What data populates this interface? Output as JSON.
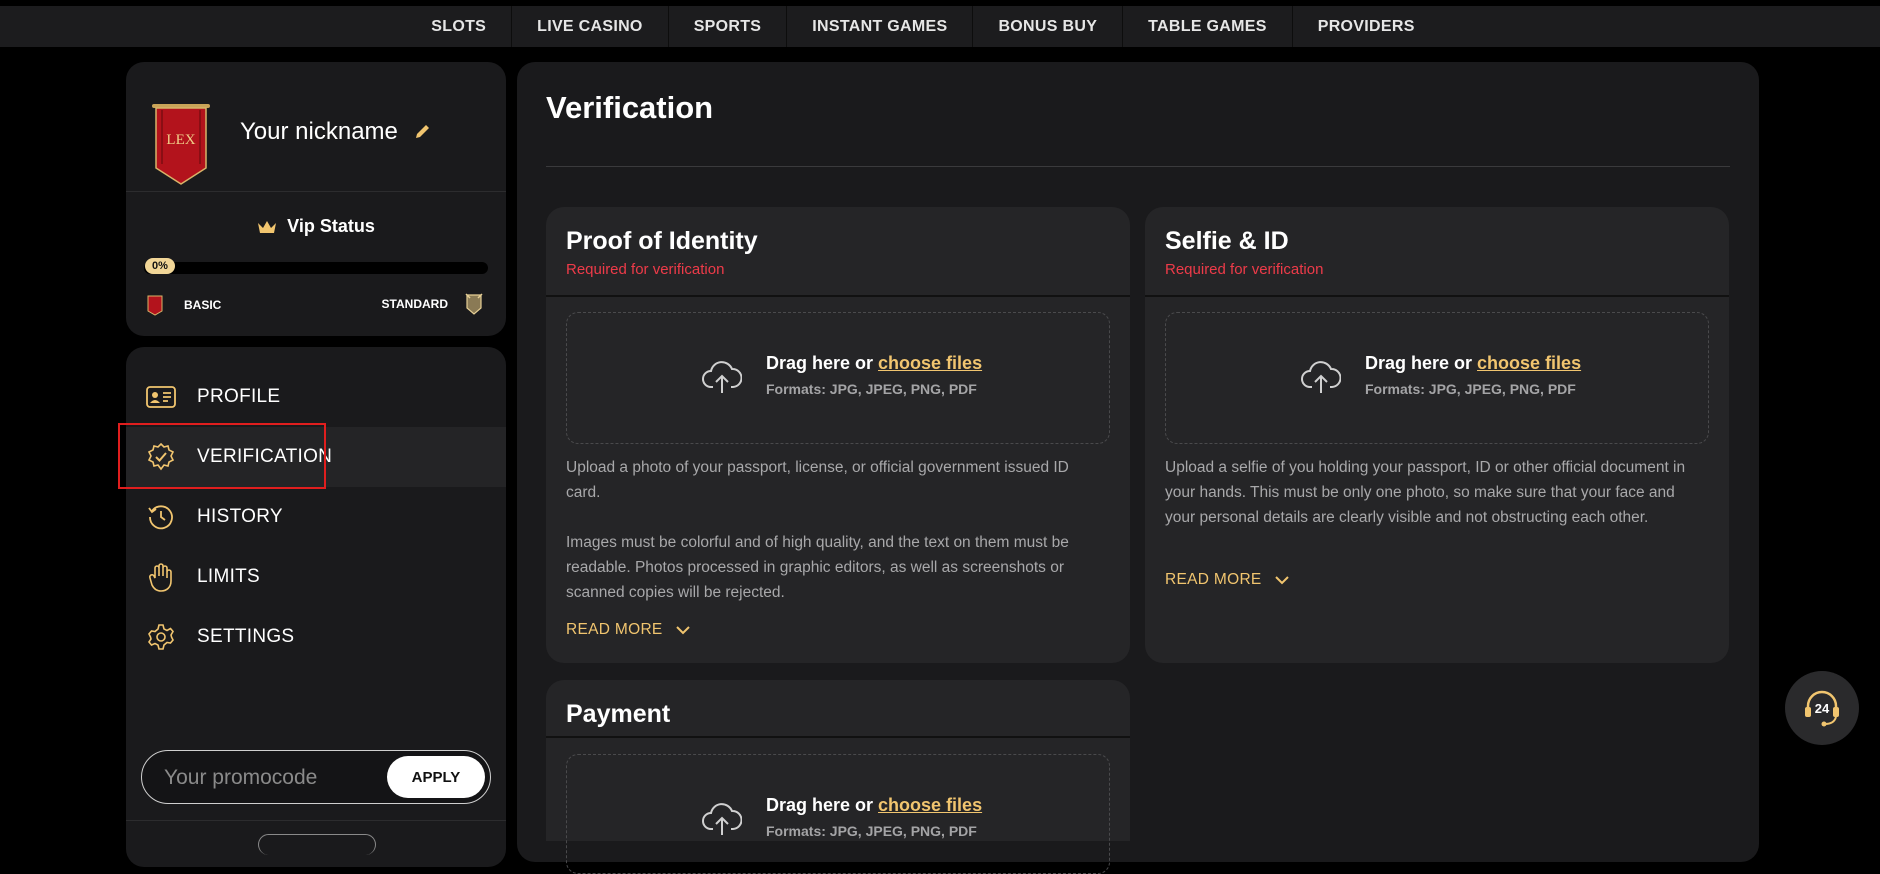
{
  "topnav": {
    "tabs": [
      "SLOTS",
      "LIVE CASINO",
      "SPORTS",
      "INSTANT GAMES",
      "BONUS BUY",
      "TABLE GAMES",
      "PROVIDERS"
    ]
  },
  "profile": {
    "logo_text": "LEX",
    "nickname": "Your nickname",
    "vip_label": "Vip Status",
    "progress_text": "0%",
    "progress_value": 0,
    "level_current": "BASIC",
    "level_next": "STANDARD"
  },
  "menu": {
    "items": [
      {
        "label": "PROFILE",
        "icon": "id-card-icon"
      },
      {
        "label": "VERIFICATION",
        "icon": "verified-badge-icon"
      },
      {
        "label": "HISTORY",
        "icon": "history-icon"
      },
      {
        "label": "LIMITS",
        "icon": "hand-icon"
      },
      {
        "label": "SETTINGS",
        "icon": "gear-icon"
      }
    ],
    "active_index": 1
  },
  "promo": {
    "placeholder": "Your promocode",
    "apply_label": "APPLY"
  },
  "main": {
    "title": "Verification",
    "cards": [
      {
        "title": "Proof of Identity",
        "required": "Required for verification",
        "drag_text": "Drag here or ",
        "choose_files": "choose files",
        "formats": "Formats: JPG, JPEG, PNG, PDF",
        "desc1": "Upload a photo of your passport, license, or official government issued ID card.",
        "desc2": "Images must be colorful and of high quality, and the text on them must be readable. Photos processed in graphic editors, as well as screenshots or scanned copies will be rejected.",
        "read_more": "READ MORE"
      },
      {
        "title": "Selfie & ID",
        "required": "Required for verification",
        "drag_text": "Drag here or ",
        "choose_files": "choose files",
        "formats": "Formats: JPG, JPEG, PNG, PDF",
        "desc1": "Upload a selfie of you holding your passport, ID or other official document in your hands. This must be only one photo, so make sure that your face and your personal details are clearly visible and not obstructing each other.",
        "read_more": "READ MORE"
      },
      {
        "title": "Payment",
        "drag_text": "Drag here or ",
        "choose_files": "choose files",
        "formats": "Formats: JPG, JPEG, PNG, PDF"
      }
    ]
  },
  "support": {
    "label": "24",
    "icon": "headset-support-icon"
  },
  "colors": {
    "accent_gold": "#f1c56f",
    "required_red": "#ee3b49",
    "highlight_red": "#e01e1e"
  }
}
